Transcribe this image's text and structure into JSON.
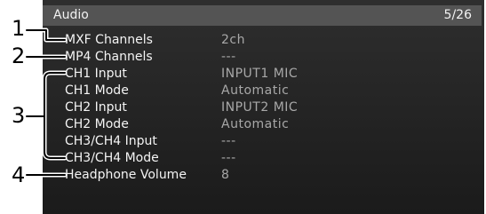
{
  "header": {
    "title": "Audio",
    "page_indicator": "5/26"
  },
  "settings": [
    {
      "label": "MXF Channels",
      "value": "2ch"
    },
    {
      "label": "MP4 Channels",
      "value": "---"
    },
    {
      "label": "CH1 Input",
      "value": "INPUT1 MIC"
    },
    {
      "label": "CH1 Mode",
      "value": "Automatic"
    },
    {
      "label": "CH2 Input",
      "value": "INPUT2 MIC"
    },
    {
      "label": "CH2 Mode",
      "value": "Automatic"
    },
    {
      "label": "CH3/CH4 Input",
      "value": "---"
    },
    {
      "label": "CH3/CH4 Mode",
      "value": "---"
    },
    {
      "label": "Headphone Volume",
      "value": "8"
    }
  ],
  "callouts": [
    "1",
    "2",
    "3",
    "4"
  ],
  "colors": {
    "screen_background": "#232323",
    "title_bar": "#545454",
    "label_text": "#f4f4f4",
    "value_text": "#a8a8a8",
    "callout_ink": "#000000"
  }
}
